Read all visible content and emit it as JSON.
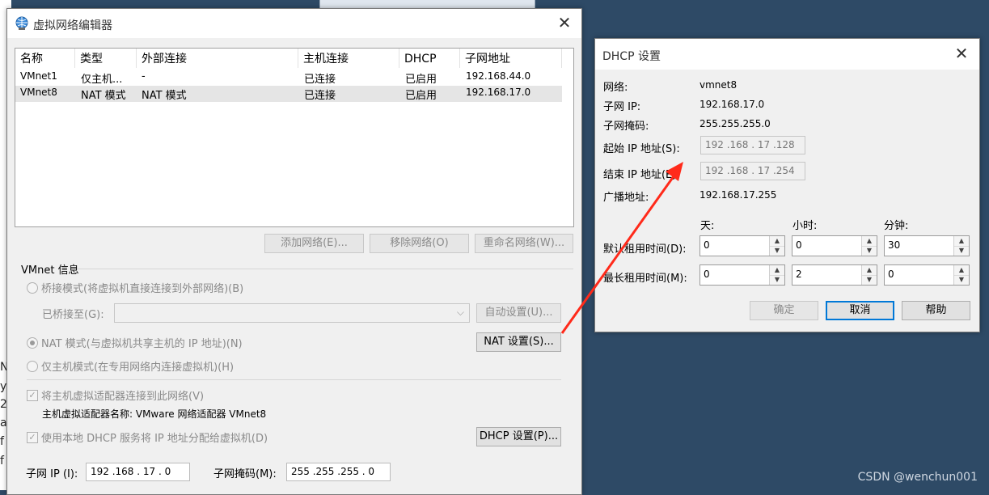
{
  "left_window": {
    "title": "虚拟网络编辑器",
    "close": "✕",
    "columns": [
      "名称",
      "类型",
      "外部连接",
      "主机连接",
      "DHCP",
      "子网地址"
    ],
    "rows": [
      {
        "name": "VMnet1",
        "type": "仅主机...",
        "external": "-",
        "host": "已连接",
        "dhcp": "已启用",
        "subnet": "192.168.44.0",
        "selected": false
      },
      {
        "name": "VMnet8",
        "type": "NAT 模式",
        "external": "NAT 模式",
        "host": "已连接",
        "dhcp": "已启用",
        "subnet": "192.168.17.0",
        "selected": true
      }
    ],
    "buttons": {
      "add": "添加网络(E)...",
      "remove": "移除网络(O)",
      "rename": "重命名网络(W)..."
    },
    "vmnet_info": {
      "group_label": "VMnet 信息",
      "bridged": "桥接模式(将虚拟机直接连接到外部网络)(B)",
      "bridged_to_label": "已桥接至(G):",
      "auto_settings": "自动设置(U)...",
      "nat": "NAT 模式(与虚拟机共享主机的 IP 地址)(N)",
      "nat_settings": "NAT 设置(S)...",
      "hostonly": "仅主机模式(在专用网络内连接虚拟机)(H)",
      "connect_adapter": "将主机虚拟适配器连接到此网络(V)",
      "adapter_name_label": "主机虚拟适配器名称: VMware 网络适配器 VMnet8",
      "use_dhcp": "使用本地 DHCP 服务将 IP 地址分配给虚拟机(D)",
      "dhcp_settings": "DHCP 设置(P)...",
      "subnet_ip_label": "子网 IP (I):",
      "subnet_ip_value": "192 .168 . 17 .  0",
      "subnet_mask_label": "子网掩码(M):",
      "subnet_mask_value": "255 .255 .255 .  0"
    }
  },
  "dhcp_dialog": {
    "title": "DHCP 设置",
    "close": "✕",
    "network_label": "网络:",
    "network_value": "vmnet8",
    "subnet_ip_label": "子网 IP:",
    "subnet_ip_value": "192.168.17.0",
    "subnet_mask_label": "子网掩码:",
    "subnet_mask_value": "255.255.255.0",
    "start_ip_label": "起始 IP 地址(S):",
    "start_ip_value": "192 .168 . 17 .128",
    "end_ip_label": "结束 IP 地址(E):",
    "end_ip_value": "192 .168 . 17 .254",
    "broadcast_label": "广播地址:",
    "broadcast_value": "192.168.17.255",
    "col_days": "天:",
    "col_hours": "小时:",
    "col_minutes": "分钟:",
    "default_lease_label": "默认租用时间(D):",
    "default_lease": {
      "days": "0",
      "hours": "0",
      "minutes": "30"
    },
    "max_lease_label": "最长租用时间(M):",
    "max_lease": {
      "days": "0",
      "hours": "2",
      "minutes": "0"
    },
    "ok": "确定",
    "cancel": "取消",
    "help": "帮助"
  },
  "desktop": {
    "edge_chars": [
      "N",
      "y",
      "2",
      "a",
      "f",
      "f"
    ],
    "watermark": "CSDN @wenchun001"
  },
  "colors": {
    "desktop": "#2e4a66",
    "annotation_arrow": "#ff2a1a",
    "focus": "#0078d7"
  }
}
